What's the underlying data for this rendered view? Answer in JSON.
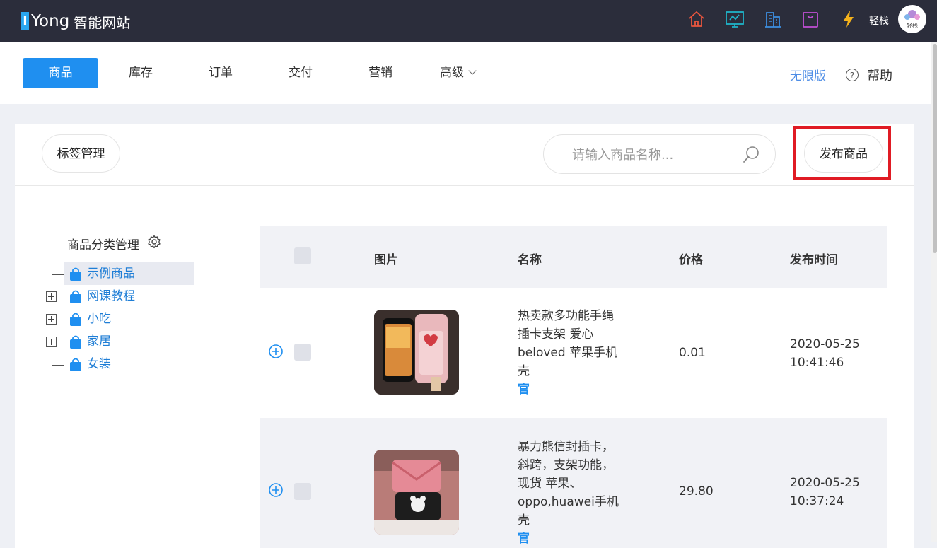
{
  "header": {
    "logo_mark": "i",
    "logo_brand": "Yong",
    "logo_suffix": "智能网站",
    "icons": [
      "home-icon",
      "monitor-icon",
      "building-icon",
      "bag-icon",
      "lightning-icon"
    ],
    "user_name": "轻栈",
    "avatar_text": "轻栈"
  },
  "nav": {
    "tabs": [
      {
        "label": "商品",
        "active": true
      },
      {
        "label": "库存"
      },
      {
        "label": "订单"
      },
      {
        "label": "交付"
      },
      {
        "label": "营销"
      },
      {
        "label": "高级"
      }
    ],
    "edition": "无限版",
    "help_icon": "?",
    "help": "帮助"
  },
  "toolbar": {
    "tag_manage": "标签管理",
    "search_placeholder": "请输入商品名称...",
    "publish": "发布商品"
  },
  "category": {
    "title": "商品分类管理",
    "nodes": [
      {
        "label": "示例商品",
        "selected": true,
        "expandable": false
      },
      {
        "label": "网课教程",
        "expandable": true
      },
      {
        "label": "小吃",
        "expandable": true
      },
      {
        "label": "家居",
        "expandable": true
      },
      {
        "label": "女装",
        "expandable": false
      }
    ]
  },
  "table": {
    "columns": [
      "图片",
      "名称",
      "价格",
      "发布时间"
    ],
    "rows": [
      {
        "name": "热卖款多功能手绳插卡支架 爱心beloved 苹果手机壳",
        "official": "官",
        "price": "0.01",
        "date": "2020-05-25",
        "time": "10:41:46"
      },
      {
        "name": "暴力熊信封插卡，斜跨，支架功能，现货 苹果、oppo,huawei手机壳",
        "official": "官",
        "price": "29.80",
        "date": "2020-05-25",
        "time": "10:37:24"
      }
    ]
  },
  "colors": {
    "topbar": "#2b2d3b",
    "accent": "#1f8ff0",
    "highlight": "#e01b24"
  }
}
